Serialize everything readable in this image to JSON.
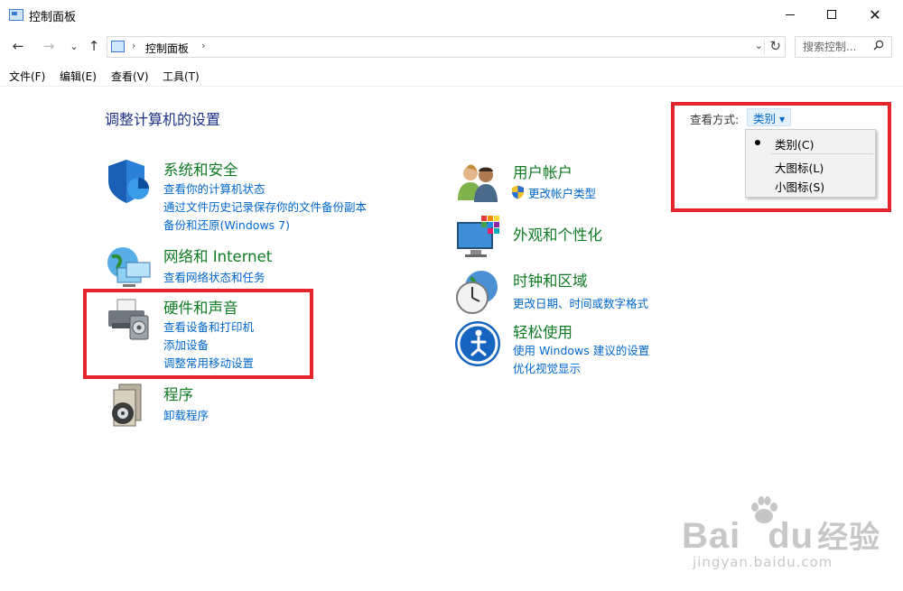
{
  "window": {
    "title": "控制面板"
  },
  "nav": {
    "back": "←",
    "forward": "→",
    "recent": "⌄",
    "up": "↑",
    "breadcrumb": "控制面板",
    "search_placeholder": "搜索控制..."
  },
  "menu": [
    "文件(F)",
    "编辑(E)",
    "查看(V)",
    "工具(T)"
  ],
  "content": {
    "title": "调整计算机的设置",
    "view_by_label": "查看方式:",
    "view_by_value": "类别",
    "view_options": [
      {
        "label": "类别(C)",
        "selected": true
      },
      {
        "label": "大图标(L)",
        "selected": false
      },
      {
        "label": "小图标(S)",
        "selected": false
      }
    ],
    "categories_left": [
      {
        "title": "系统和安全",
        "icon": "shield-icon",
        "links": [
          "查看你的计算机状态",
          "通过文件历史记录保存你的文件备份副本",
          "备份和还原(Windows 7)"
        ]
      },
      {
        "title": "网络和 Internet",
        "icon": "network-icon",
        "links": [
          "查看网络状态和任务"
        ]
      },
      {
        "title": "硬件和声音",
        "icon": "printer-icon",
        "links": [
          "查看设备和打印机",
          "添加设备",
          "调整常用移动设置"
        ]
      },
      {
        "title": "程序",
        "icon": "programs-icon",
        "links": [
          "卸载程序"
        ]
      }
    ],
    "categories_right": [
      {
        "title": "用户帐户",
        "icon": "users-icon",
        "links": [
          "更改帐户类型"
        ]
      },
      {
        "title": "外观和个性化",
        "icon": "appearance-icon",
        "links": []
      },
      {
        "title": "时钟和区域",
        "icon": "clock-icon",
        "links": [
          "更改日期、时间或数字格式"
        ]
      },
      {
        "title": "轻松使用",
        "icon": "ease-of-access-icon",
        "links": [
          "使用 Windows 建议的设置",
          "优化视觉显示"
        ]
      }
    ]
  },
  "watermark": {
    "brand": "Bai",
    "brand2": "du",
    "cn": "经验",
    "url": "jingyan.baidu.com"
  },
  "colors": {
    "category_title": "#0f7b23",
    "link": "#0066cc",
    "page_title": "#1e3287",
    "highlight_box": "#e4262c"
  }
}
